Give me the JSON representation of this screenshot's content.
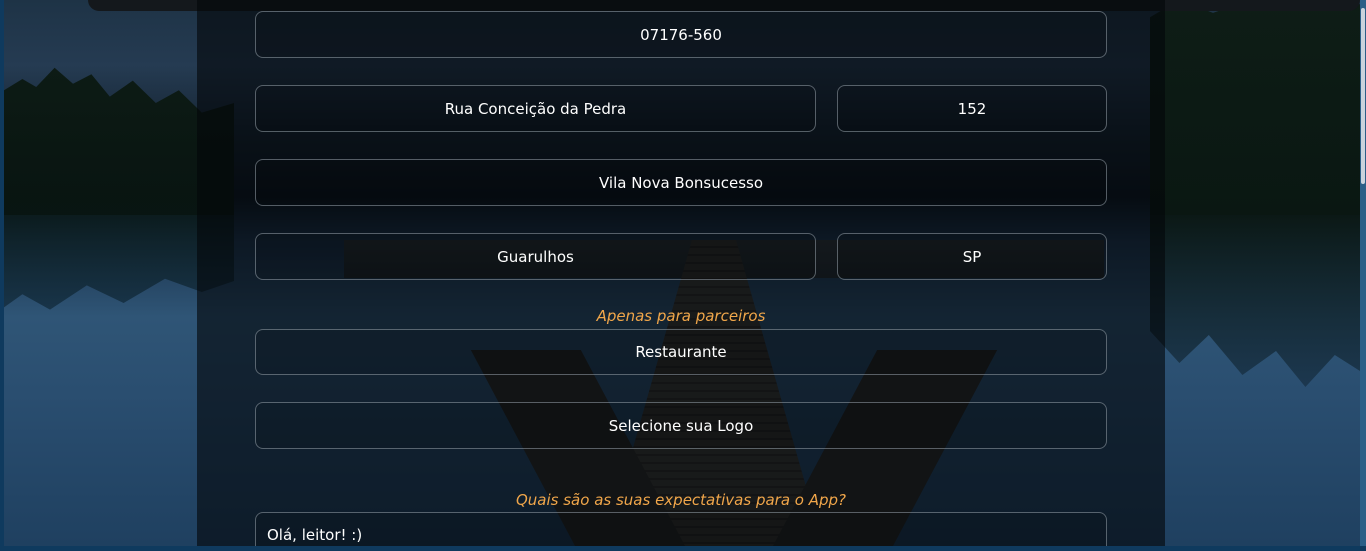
{
  "form": {
    "cep": {
      "value": "07176-560"
    },
    "street": {
      "value": "Rua Conceição da Pedra"
    },
    "number": {
      "value": "152"
    },
    "neighborhood": {
      "value": "Vila Nova Bonsucesso"
    },
    "city": {
      "value": "Guarulhos"
    },
    "state": {
      "value": "SP"
    },
    "partners_label": "Apenas para parceiros",
    "business_type": {
      "selected": "Restaurante"
    },
    "logo_upload": {
      "label": "Selecione sua Logo"
    },
    "expectations_label": "Quais são as suas expectativas para o App?",
    "expectations": {
      "value": "Olá, leitor! :)"
    }
  },
  "colors": {
    "accent": "#f0a64a",
    "text": "#ffffff",
    "field_border": "#8f9aa5",
    "page_edge": "#0f3a5e"
  }
}
